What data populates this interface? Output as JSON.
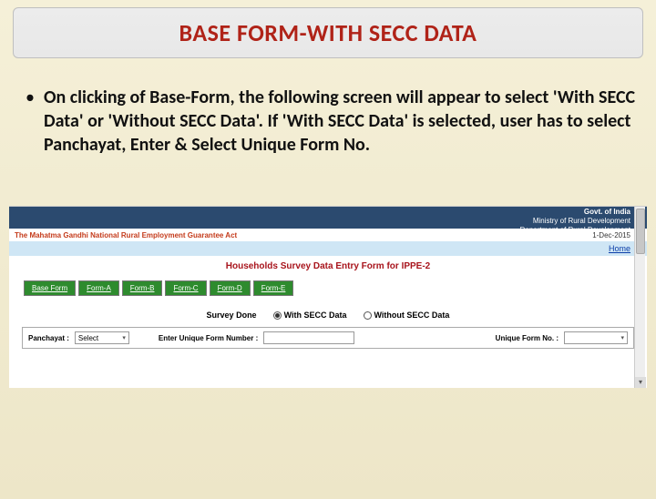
{
  "title": "BASE FORM-WITH  SECC DATA",
  "bullet": "On clicking of Base-Form, the following screen will appear to select 'With SECC Data' or 'Without SECC Data'. If 'With SECC Data' is selected, user has to select Panchayat, Enter & Select Unique Form No.",
  "gov": {
    "line1": "Govt. of India",
    "line2": "Ministry of Rural Development",
    "line3": "Department of Rural Development"
  },
  "act": "The Mahatma Gandhi National Rural Employment Guarantee Act",
  "date": "1-Dec-2015",
  "home_link": "Home",
  "form_title": "Households Survey Data Entry Form for IPPE-2",
  "tabs": [
    "Base Form",
    "Form-A",
    "Form-B",
    "Form-C",
    "Form-D",
    "Form-E"
  ],
  "survey": {
    "label": "Survey Done",
    "opt1": "With SECC Data",
    "opt2": "Without SECC Data"
  },
  "fields": {
    "panchayat_label": "Panchayat :",
    "panchayat_value": "Select",
    "unique_enter_label": "Enter Unique Form Number :",
    "unique_select_label": "Unique Form No. :"
  }
}
